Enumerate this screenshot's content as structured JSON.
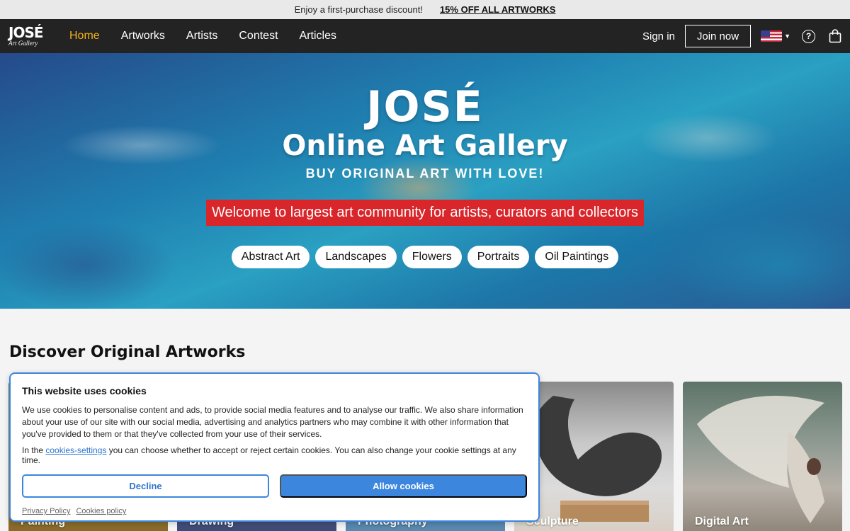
{
  "promo": {
    "text": "Enjoy a first-purchase discount!",
    "link": "15% OFF ALL ARTWORKS"
  },
  "nav": {
    "logo_big": "JOSÉ",
    "logo_small": "Art Gallery",
    "links": [
      "Home",
      "Artworks",
      "Artists",
      "Contest",
      "Articles"
    ],
    "signin": "Sign in",
    "join": "Join now",
    "help_icon": "?"
  },
  "hero": {
    "title": "JOSÉ",
    "subtitle": "Online Art Gallery",
    "tagline": "BUY ORIGINAL ART WITH LOVE!",
    "welcome": "Welcome to largest art community for artists, curators and collectors",
    "chips": [
      "Abstract Art",
      "Landscapes",
      "Flowers",
      "Portraits",
      "Oil Paintings"
    ]
  },
  "discover": {
    "title": "Discover Original Artworks",
    "cards": [
      "Painting",
      "Drawing",
      "Photography",
      "Sculpture",
      "Digital Art"
    ]
  },
  "cookie": {
    "title": "This website uses cookies",
    "body": "We use cookies to personalise content and ads, to provide social media features and to analyse our traffic. We also share information about your use of our site with our social media, advertising and analytics partners who may combine it with other information that you've provided to them or that they've collected from your use of their services.",
    "settings_prefix": "In the ",
    "settings_link": "cookies-settings",
    "settings_suffix": " you can choose whether to accept or reject certain cookies. You can also change your cookie settings at any time.",
    "decline": "Decline",
    "allow": "Allow cookies",
    "privacy": "Privacy Policy",
    "cookies_policy": "Cookies policy"
  },
  "colors": {
    "accent": "#f6b21b",
    "welcome_bg": "#d8262b",
    "cookie_blue": "#3c86de",
    "nav_bg": "#232323"
  }
}
